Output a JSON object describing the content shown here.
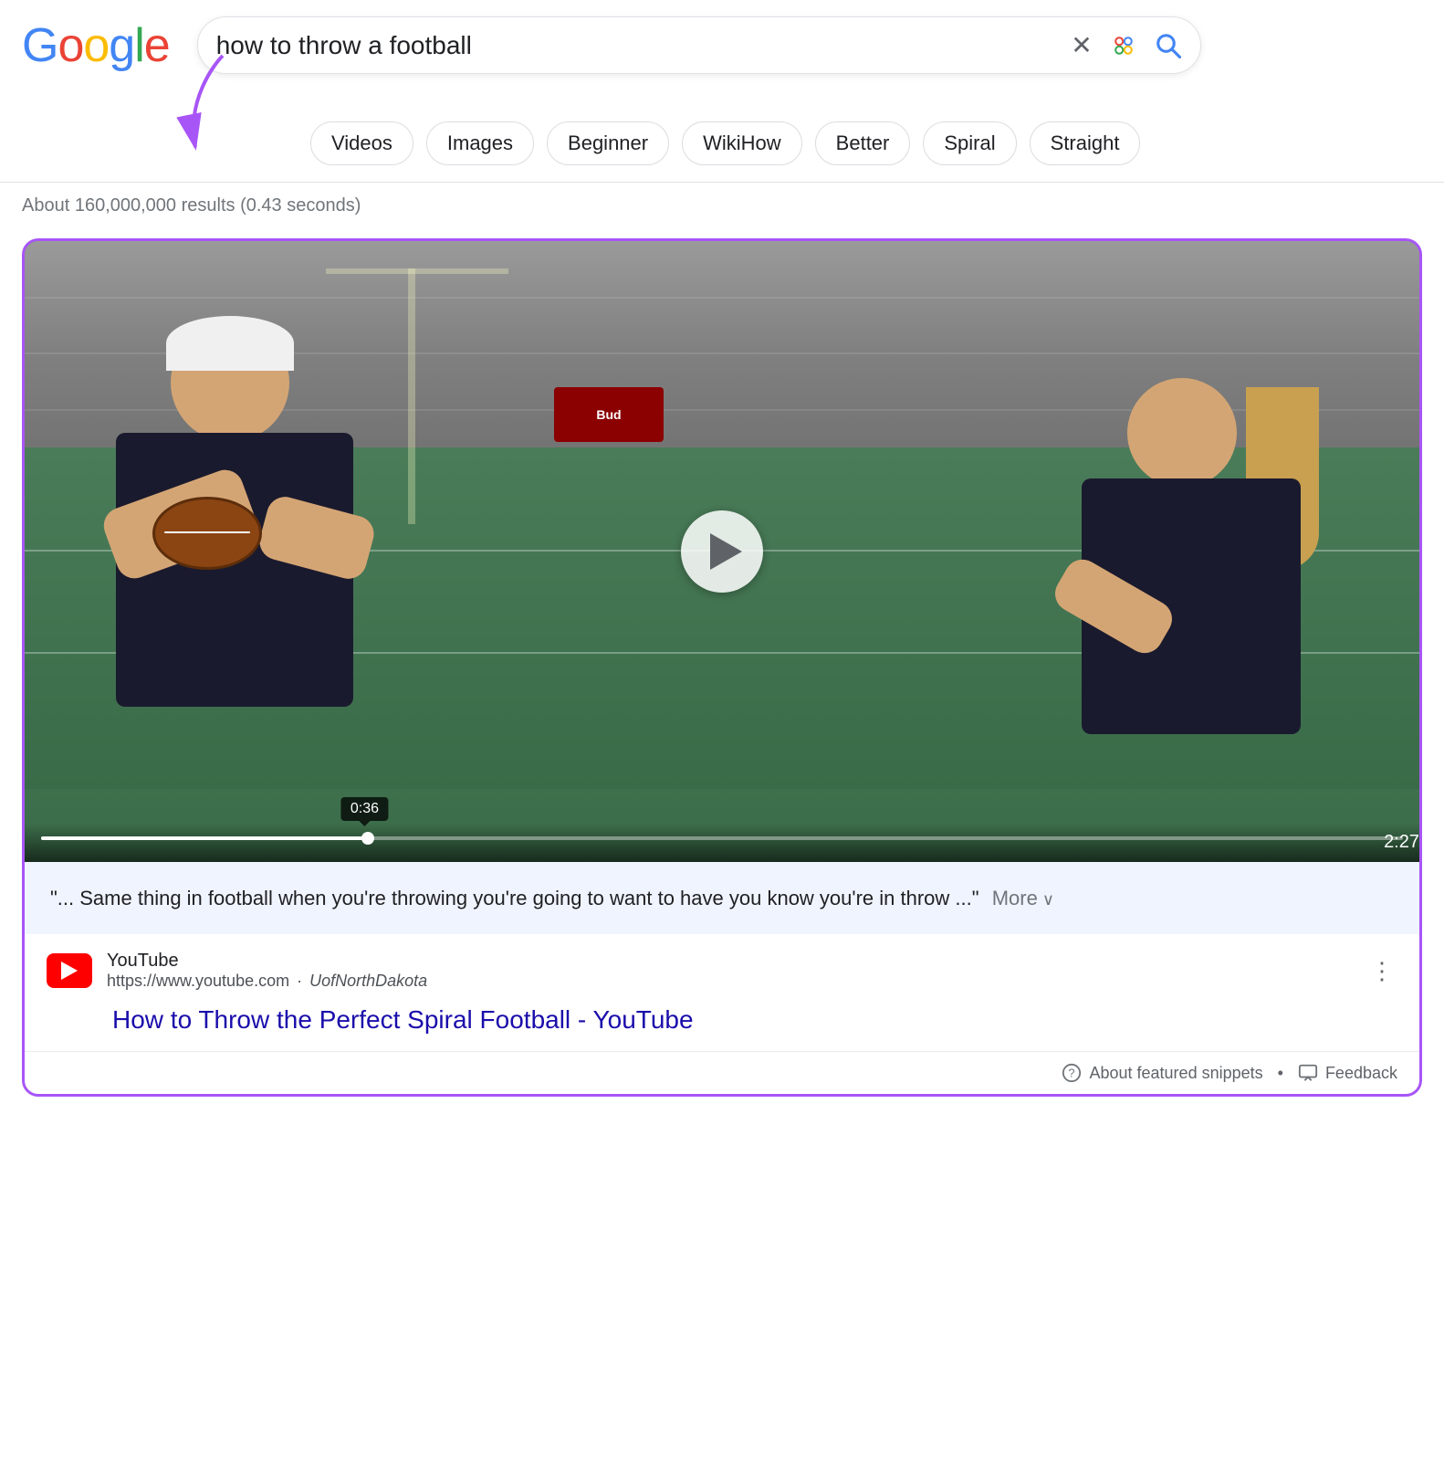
{
  "google": {
    "logo_letters": [
      {
        "char": "G",
        "color": "#4285F4"
      },
      {
        "char": "o",
        "color": "#EA4335"
      },
      {
        "char": "o",
        "color": "#FBBC05"
      },
      {
        "char": "g",
        "color": "#4285F4"
      },
      {
        "char": "l",
        "color": "#34A853"
      },
      {
        "char": "e",
        "color": "#EA4335"
      }
    ]
  },
  "search": {
    "query": "how to throw a football",
    "clear_label": "×",
    "results_count": "About 160,000,000 results (0.43 seconds)"
  },
  "filters": [
    {
      "label": "Videos"
    },
    {
      "label": "Images"
    },
    {
      "label": "Beginner"
    },
    {
      "label": "WikiHow"
    },
    {
      "label": "Better"
    },
    {
      "label": "Spiral"
    },
    {
      "label": "Straight"
    }
  ],
  "featured_snippet": {
    "video": {
      "current_time": "0:36",
      "duration": "2:27",
      "progress_percent": 24
    },
    "transcript": "\"... Same thing in football when you're throwing you're going to want to have you know you're in throw ...\"",
    "more_label": "More",
    "source": {
      "platform": "YouTube",
      "url": "https://www.youtube.com",
      "channel": "UofNorthDakota",
      "title": "How to Throw the Perfect Spiral Football - YouTube"
    },
    "footer": {
      "about_label": "About featured snippets",
      "feedback_label": "Feedback"
    }
  }
}
